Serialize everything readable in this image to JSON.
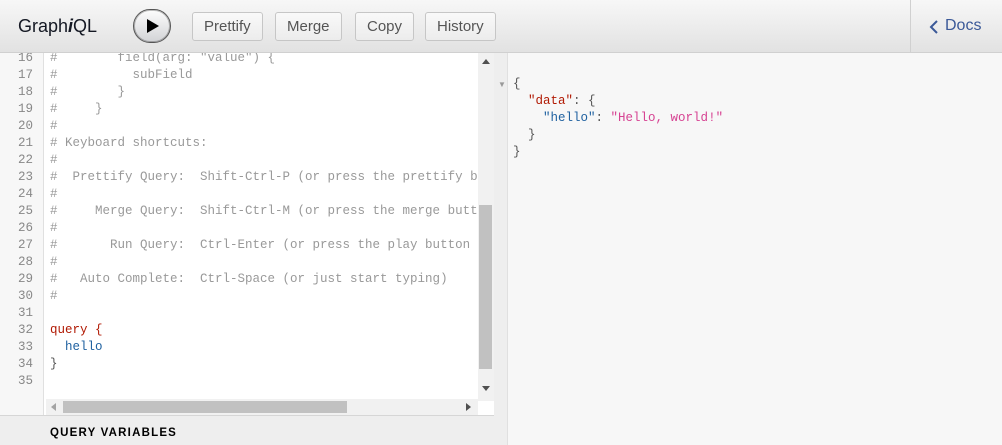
{
  "app": {
    "title_prefix": "Graph",
    "title_em": "i",
    "title_suffix": "QL"
  },
  "toolbar": {
    "prettify_label": "Prettify",
    "merge_label": "Merge",
    "copy_label": "Copy",
    "history_label": "History",
    "play_icon": "play-icon"
  },
  "docs": {
    "label": "Docs",
    "icon": "chevron-left-icon"
  },
  "editor": {
    "lines": [
      {
        "n": "16",
        "text": "#        field(arg: \"value\") {",
        "cls": "tx"
      },
      {
        "n": "17",
        "text": "#          subField",
        "cls": "tx"
      },
      {
        "n": "18",
        "text": "#        }",
        "cls": "tx"
      },
      {
        "n": "19",
        "text": "#     }",
        "cls": "tx"
      },
      {
        "n": "20",
        "text": "#",
        "cls": "tx"
      },
      {
        "n": "21",
        "text": "# Keyboard shortcuts:",
        "cls": "tx"
      },
      {
        "n": "22",
        "text": "#",
        "cls": "tx"
      },
      {
        "n": "23",
        "text": "#  Prettify Query:  Shift-Ctrl-P (or press the prettify button above)",
        "cls": "tx"
      },
      {
        "n": "24",
        "text": "#",
        "cls": "tx"
      },
      {
        "n": "25",
        "text": "#     Merge Query:  Shift-Ctrl-M (or press the merge button above)",
        "cls": "tx"
      },
      {
        "n": "26",
        "text": "#",
        "cls": "tx"
      },
      {
        "n": "27",
        "text": "#       Run Query:  Ctrl-Enter (or press the play button above)",
        "cls": "tx"
      },
      {
        "n": "28",
        "text": "#",
        "cls": "tx"
      },
      {
        "n": "29",
        "text": "#   Auto Complete:  Ctrl-Space (or just start typing)",
        "cls": "tx"
      },
      {
        "n": "30",
        "text": "#",
        "cls": "tx"
      },
      {
        "n": "31",
        "text": "",
        "cls": "tx"
      },
      {
        "n": "32",
        "text": "query {",
        "cls": "kw"
      },
      {
        "n": "33",
        "text": "  hello",
        "cls": "fld"
      },
      {
        "n": "34",
        "text": "}",
        "cls": "punc"
      },
      {
        "n": "35",
        "text": "",
        "cls": "tx"
      }
    ]
  },
  "variables": {
    "label": "QUERY VARIABLES"
  },
  "result": {
    "open_brace": "{",
    "data_key": "\"data\"",
    "data_open": ": {",
    "hello_key": "\"hello\"",
    "hello_colon": ": ",
    "hello_value": "\"Hello, world!\"",
    "inner_close": "}",
    "outer_close": "}"
  },
  "colors": {
    "keyword": "#b11a04",
    "field": "#1f61a0",
    "string": "#d64292",
    "comment": "#999999",
    "link": "#3b5998"
  }
}
